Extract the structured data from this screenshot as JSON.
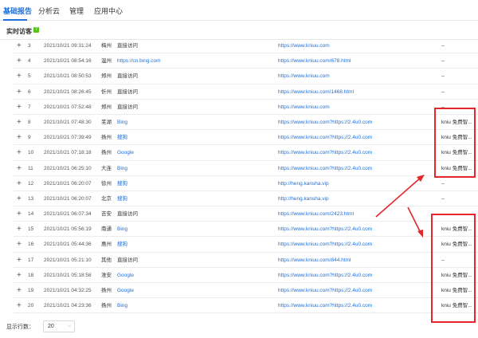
{
  "nav": {
    "tabs": [
      {
        "label": "基础报告",
        "active": true
      },
      {
        "label": "分析云",
        "active": false
      },
      {
        "label": "管理",
        "active": false
      },
      {
        "label": "应用中心",
        "active": false
      }
    ]
  },
  "section": {
    "title": "实时访客",
    "badge": "?"
  },
  "table": {
    "rows": [
      {
        "idx": "3",
        "time": "2021/10/21 09:31:24",
        "loc": "梅州",
        "src": "直接访问",
        "src_link": false,
        "land": "https://www.kniuu.com",
        "extra": "--"
      },
      {
        "idx": "4",
        "time": "2021/10/21 08:54:16",
        "loc": "温州",
        "src": "https://cn.bing.com",
        "src_link": true,
        "land": "https://www.kniuu.com/678.html",
        "extra": "--"
      },
      {
        "idx": "5",
        "time": "2021/10/21 08:50:53",
        "loc": "郑州",
        "src": "直接访问",
        "src_link": false,
        "land": "https://www.kniuu.com",
        "extra": "--"
      },
      {
        "idx": "6",
        "time": "2021/10/21 08:26:45",
        "loc": "忻州",
        "src": "直接访问",
        "src_link": false,
        "land": "https://www.kniuu.com/1468.html",
        "extra": "--"
      },
      {
        "idx": "7",
        "time": "2021/10/21 07:52:48",
        "loc": "郑州",
        "src": "直接访问",
        "src_link": false,
        "land": "https://www.kniuu.com",
        "extra": "--"
      },
      {
        "idx": "8",
        "time": "2021/10/21 07:48:30",
        "loc": "芜湖",
        "src": "Bing",
        "src_link": true,
        "land": "https://www.kniuu.com?https://2.4u0.com",
        "extra": "kniu 免费智..."
      },
      {
        "idx": "9",
        "time": "2021/10/21 07:39:49",
        "loc": "扬州",
        "src": "搜狗",
        "src_link": true,
        "land": "https://www.kniuu.com?https://2.4u0.com",
        "extra": "kniu 免费智..."
      },
      {
        "idx": "10",
        "time": "2021/10/21 07:18:18",
        "loc": "扬州",
        "src": "Google",
        "src_link": true,
        "land": "https://www.kniuu.com?https://2.4u0.com",
        "extra": "kniu 免费智..."
      },
      {
        "idx": "11",
        "time": "2021/10/21 06:25:10",
        "loc": "大连",
        "src": "Bing",
        "src_link": true,
        "land": "https://www.kniuu.com?https://2.4u0.com",
        "extra": "kniu 免费智..."
      },
      {
        "idx": "12",
        "time": "2021/10/21 06:20:07",
        "loc": "徐州",
        "src": "搜狗",
        "src_link": true,
        "land": "http://heng.kansha.vip",
        "extra": "--"
      },
      {
        "idx": "13",
        "time": "2021/10/21 06:20:07",
        "loc": "北京",
        "src": "搜狗",
        "src_link": true,
        "land": "http://heng.kansha.vip",
        "extra": "--"
      },
      {
        "idx": "14",
        "time": "2021/10/21 06:07:34",
        "loc": "吉安",
        "src": "直接访问",
        "src_link": false,
        "land": "https://www.kniuu.com/2423.html",
        "extra": ""
      },
      {
        "idx": "15",
        "time": "2021/10/21 05:56:19",
        "loc": "南通",
        "src": "Bing",
        "src_link": true,
        "land": "https://www.kniuu.com?https://2.4u0.com",
        "extra": "kniu 免费智..."
      },
      {
        "idx": "16",
        "time": "2021/10/21 05:44:36",
        "loc": "惠州",
        "src": "搜狗",
        "src_link": true,
        "land": "https://www.kniuu.com?https://2.4u0.com",
        "extra": "kniu 免费智..."
      },
      {
        "idx": "17",
        "time": "2021/10/21 05:21:10",
        "loc": "其他",
        "src": "直接访问",
        "src_link": false,
        "land": "https://www.kniuu.com/844.html",
        "extra": "--"
      },
      {
        "idx": "18",
        "time": "2021/10/21 05:18:58",
        "loc": "淮安",
        "src": "Google",
        "src_link": true,
        "land": "https://www.kniuu.com?https://2.4u0.com",
        "extra": "kniu 免费智..."
      },
      {
        "idx": "19",
        "time": "2021/10/21 04:32:25",
        "loc": "扬州",
        "src": "Google",
        "src_link": true,
        "land": "https://www.kniuu.com?https://2.4u0.com",
        "extra": "kniu 免费智..."
      },
      {
        "idx": "20",
        "time": "2021/10/21 04:23:36",
        "loc": "扬州",
        "src": "Bing",
        "src_link": true,
        "land": "https://www.kniuu.com?https://2.4u0.com",
        "extra": "kniu 免费智..."
      }
    ]
  },
  "footer": {
    "rows_label": "显示行数：",
    "rows_value": "20"
  },
  "colors": {
    "accent": "#1e6fd9",
    "highlight": "#e5262b"
  }
}
